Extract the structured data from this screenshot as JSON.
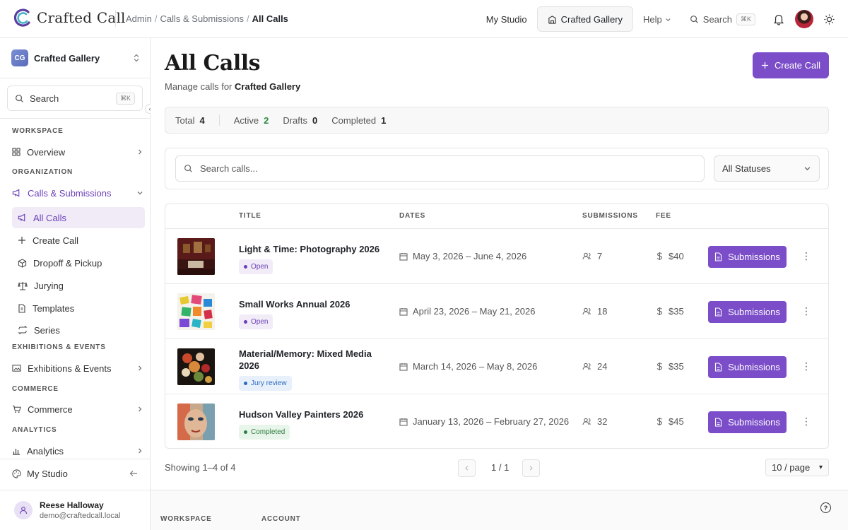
{
  "app": {
    "name": "Crafted Call"
  },
  "breadcrumb": [
    "Admin",
    "Calls & Submissions",
    "All Calls"
  ],
  "topnav": {
    "my_studio": "My Studio",
    "gallery": "Crafted Gallery",
    "help": "Help",
    "search": "Search",
    "kbd": "⌘K"
  },
  "sidebar": {
    "org_badge": "CG",
    "org_name": "Crafted Gallery",
    "search_label": "Search",
    "search_kbd": "⌘K",
    "sections": {
      "workspace": "WORKSPACE",
      "organization": "ORGANIZATION",
      "exhibitions": "EXHIBITIONS & EVENTS",
      "commerce": "COMMERCE",
      "analytics": "ANALYTICS"
    },
    "items": {
      "overview": "Overview",
      "calls": "Calls & Submissions",
      "all_calls": "All Calls",
      "create_call": "Create Call",
      "dropoff": "Dropoff & Pickup",
      "jurying": "Jurying",
      "templates": "Templates",
      "series": "Series",
      "exhibitions": "Exhibitions & Events",
      "commerce": "Commerce",
      "analytics": "Analytics"
    },
    "footer_link": "My Studio",
    "user": {
      "name": "Reese Halloway",
      "email": "demo@craftedcall.local"
    }
  },
  "main": {
    "title": "All Calls",
    "subtitle_prefix": "Manage calls for",
    "subtitle_org": "Crafted Gallery",
    "create_button": "Create Call",
    "stats": [
      {
        "label": "Total",
        "value": "4"
      },
      {
        "label": "Active",
        "value": "2"
      },
      {
        "label": "Drafts",
        "value": "0"
      },
      {
        "label": "Completed",
        "value": "1"
      }
    ],
    "search_placeholder": "Search calls...",
    "status_filter": "All Statuses",
    "columns": {
      "title": "TITLE",
      "dates": "DATES",
      "submissions": "SUBMISSIONS",
      "fee": "FEE"
    },
    "rows": [
      {
        "title": "Light & Time: Photography 2026",
        "status": "Open",
        "dates": "May 3, 2026 – June 4, 2026",
        "submissions": "7",
        "fee": "$40",
        "action": "Submissions"
      },
      {
        "title": "Small Works Annual 2026",
        "status": "Open",
        "dates": "April 23, 2026 – May 21, 2026",
        "submissions": "18",
        "fee": "$35",
        "action": "Submissions"
      },
      {
        "title": "Material/Memory: Mixed Media 2026",
        "status": "Jury review",
        "dates": "March 14, 2026 – May 8, 2026",
        "submissions": "24",
        "fee": "$35",
        "action": "Submissions"
      },
      {
        "title": "Hudson Valley Painters 2026",
        "status": "Completed",
        "dates": "January 13, 2026 – February 27, 2026",
        "submissions": "32",
        "fee": "$45",
        "action": "Submissions"
      }
    ],
    "pager": {
      "showing": "Showing 1–4 of 4",
      "page": "1 / 1",
      "per_page": "10 / page"
    },
    "footer": {
      "workspace": "WORKSPACE",
      "account": "ACCOUNT"
    }
  },
  "colors": {
    "accent": "#7b4dc9",
    "active_green": "#2f8a47"
  }
}
